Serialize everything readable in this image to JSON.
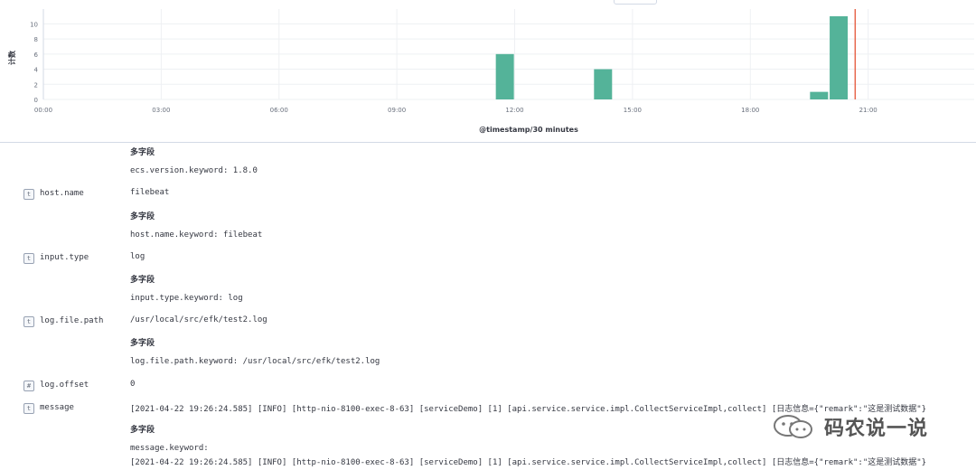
{
  "chart_data": {
    "type": "bar",
    "ylabel": "计数",
    "xlabel": "@timestamp/30 minutes",
    "y_ticks": [
      "0",
      "2",
      "4",
      "6",
      "8",
      "10"
    ],
    "x_ticks": [
      "00:00",
      "03:00",
      "06:00",
      "09:00",
      "12:00",
      "15:00",
      "18:00",
      "21:00"
    ],
    "ylim": [
      0,
      11
    ],
    "bar_color": "#54b399",
    "marker_color": "#e7664c",
    "x_unit": "hours",
    "bars": [
      {
        "x": 11.75,
        "value": 6
      },
      {
        "x": 14.25,
        "value": 4
      },
      {
        "x": 19.75,
        "value": 1
      },
      {
        "x": 20.25,
        "value": 11
      }
    ],
    "now_marker_x": 20.67,
    "xlim": [
      0,
      23.7
    ],
    "grid": true
  },
  "doc": {
    "top_multi": "多字段",
    "top_keyword": "ecs.version.keyword: 1.8.0",
    "fields": [
      {
        "type": "t",
        "name": "host.name",
        "value": "filebeat",
        "multi": "多字段",
        "keyword": "host.name.keyword: filebeat"
      },
      {
        "type": "t",
        "name": "input.type",
        "value": "log",
        "multi": "多字段",
        "keyword": "input.type.keyword: log"
      },
      {
        "type": "t",
        "name": "log.file.path",
        "value": "/usr/local/src/efk/test2.log",
        "multi": "多字段",
        "keyword": "log.file.path.keyword: /usr/local/src/efk/test2.log"
      },
      {
        "type": "#",
        "name": "log.offset",
        "value": "0"
      },
      {
        "type": "t",
        "name": "message",
        "value": "[2021-04-22 19:26:24.585] [INFO] [http-nio-8100-exec-8-63] [serviceDemo] [1] [api.service.service.impl.CollectServiceImpl,collect] [日志信息={\"remark\":\"这是测试数据\"}",
        "multi": "多字段",
        "keyword_label": "message.keyword:",
        "keyword_value": "[2021-04-22 19:26:24.585] [INFO] [http-nio-8100-exec-8-63] [serviceDemo] [1] [api.service.service.impl.CollectServiceImpl,collect] [日志信息={\"remark\":\"这是测试数据\"}"
      }
    ]
  },
  "watermark": {
    "text": "码农说一说",
    "icon": "wechat-logo-icon"
  }
}
